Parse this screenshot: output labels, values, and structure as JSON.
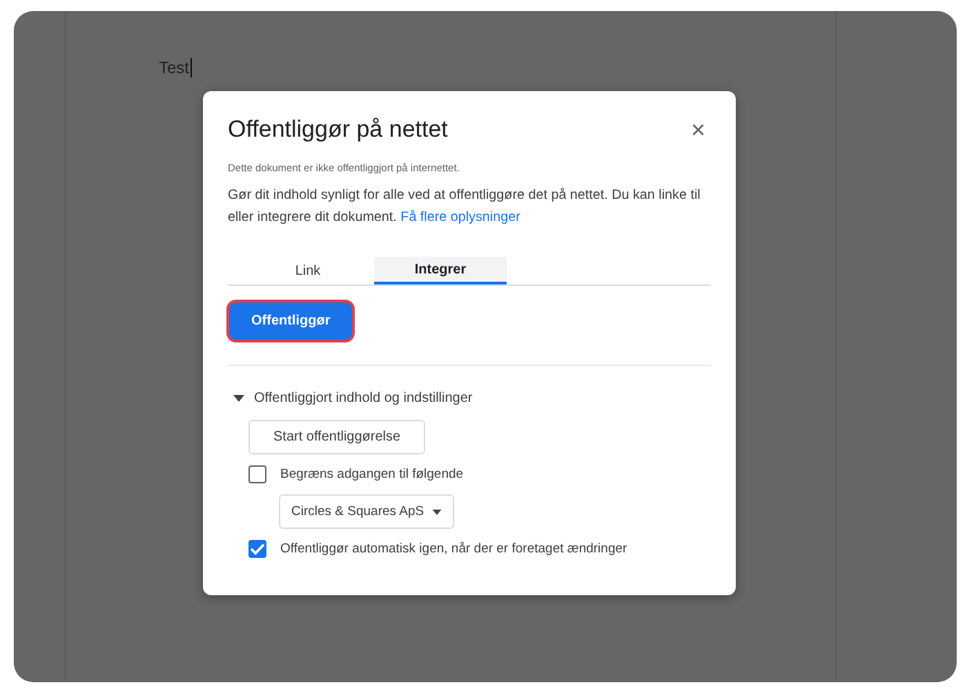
{
  "document": {
    "text": "Test"
  },
  "dialog": {
    "title": "Offentliggør på nettet",
    "close": "×",
    "status": "Dette dokument er ikke offentliggjort på internettet.",
    "description": "Gør dit indhold synligt for alle ved at offentliggøre det på nettet. Du kan linke til eller integrere dit dokument.",
    "link": "Få flere oplysninger",
    "tabs": [
      {
        "label": "Link",
        "selected": false
      },
      {
        "label": "Integrer",
        "selected": true
      }
    ],
    "publish_button": "Offentliggør",
    "section": {
      "title": "Offentliggjort indhold og indstillinger",
      "expanded": true,
      "start_button": "Start offentliggørelse",
      "options": [
        {
          "kind": "checkbox",
          "label": "Begræns adgangen til følgende",
          "checked": false
        },
        {
          "kind": "dropdown",
          "value": "Circles & Squares ApS"
        },
        {
          "kind": "checkbox",
          "label": "Offentliggør automatisk igen, når der er foretaget ændringer",
          "checked": true
        }
      ]
    }
  }
}
